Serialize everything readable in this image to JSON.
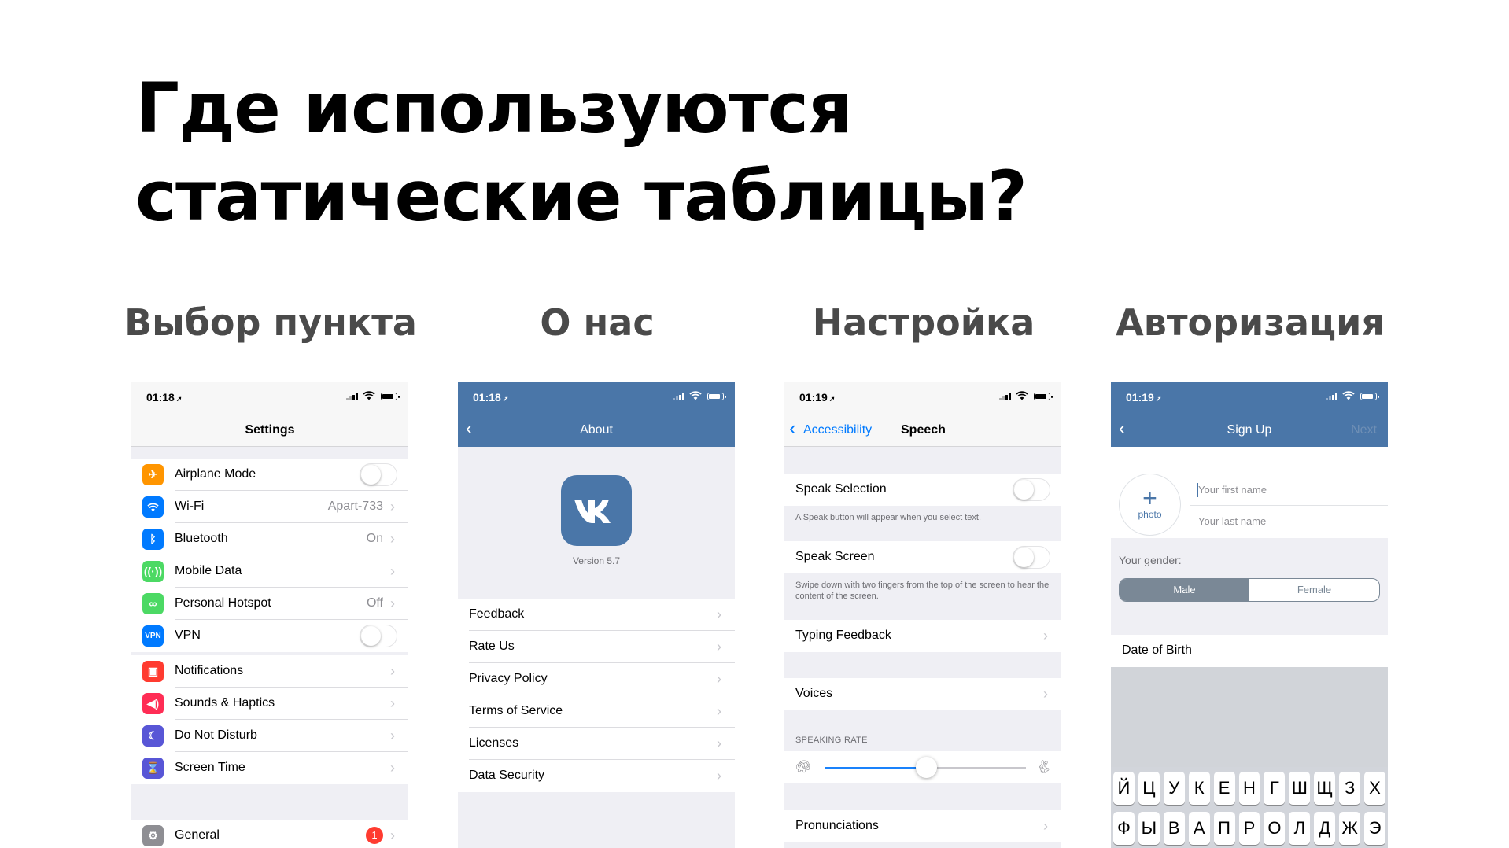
{
  "slide": {
    "title_line1": "Где используются",
    "title_line2": "статические таблицы?",
    "columns": [
      "Выбор пункта",
      "О нас",
      "Настройка",
      "Авторизация"
    ]
  },
  "settings_screen": {
    "time": "01:18",
    "title": "Settings",
    "group1": [
      {
        "label": "Airplane Mode",
        "icon": "airplane-icon",
        "color": "#ff9500",
        "toggle": false
      },
      {
        "label": "Wi-Fi",
        "icon": "wifi-icon",
        "color": "#007aff",
        "value": "Apart-733"
      },
      {
        "label": "Bluetooth",
        "icon": "bluetooth-icon",
        "color": "#007aff",
        "value": "On"
      },
      {
        "label": "Mobile Data",
        "icon": "antenna-icon",
        "color": "#4cd964"
      },
      {
        "label": "Personal Hotspot",
        "icon": "hotspot-icon",
        "color": "#4cd964",
        "value": "Off"
      },
      {
        "label": "VPN",
        "icon": "vpn-icon",
        "color": "#007aff",
        "toggle": false
      }
    ],
    "group2": [
      {
        "label": "Notifications",
        "icon": "notifications-icon",
        "color": "#ff3b30"
      },
      {
        "label": "Sounds & Haptics",
        "icon": "speaker-icon",
        "color": "#ff2d55"
      },
      {
        "label": "Do Not Disturb",
        "icon": "moon-icon",
        "color": "#5856d6"
      },
      {
        "label": "Screen Time",
        "icon": "hourglass-icon",
        "color": "#5856d6"
      }
    ],
    "group3": [
      {
        "label": "General",
        "icon": "gear-icon",
        "color": "#8e8e93",
        "badge": "1"
      }
    ]
  },
  "about_screen": {
    "time": "01:18",
    "title": "About",
    "version": "Version 5.7",
    "items": [
      "Feedback",
      "Rate Us",
      "Privacy Policy",
      "Terms of Service",
      "Licenses",
      "Data Security"
    ]
  },
  "speech_screen": {
    "time": "01:19",
    "back_label": "Accessibility",
    "title": "Speech",
    "speak_selection": "Speak Selection",
    "speak_selection_note": "A Speak button will appear when you select text.",
    "speak_screen": "Speak Screen",
    "speak_screen_note": "Swipe down with two fingers from the top of the screen to hear the content of the screen.",
    "typing_feedback": "Typing Feedback",
    "voices": "Voices",
    "speaking_rate_header": "SPEAKING RATE",
    "speaking_rate": 0.5,
    "pronunciations": "Pronunciations"
  },
  "signup_screen": {
    "time": "01:19",
    "title": "Sign Up",
    "next_label": "Next",
    "photo_label": "photo",
    "first_name_placeholder": "Your first name",
    "last_name_placeholder": "Your last name",
    "gender_label": "Your gender:",
    "gender_options": [
      "Male",
      "Female"
    ],
    "gender_selected": "Male",
    "dob_label": "Date of Birth",
    "keyboard_row1": [
      "Й",
      "Ц",
      "У",
      "К",
      "Е",
      "Н",
      "Г",
      "Ш",
      "Щ",
      "З",
      "Х"
    ],
    "keyboard_row2": [
      "Ф",
      "Ы",
      "В",
      "А",
      "П",
      "Р",
      "О",
      "Л",
      "Д",
      "Ж",
      "Э"
    ]
  }
}
